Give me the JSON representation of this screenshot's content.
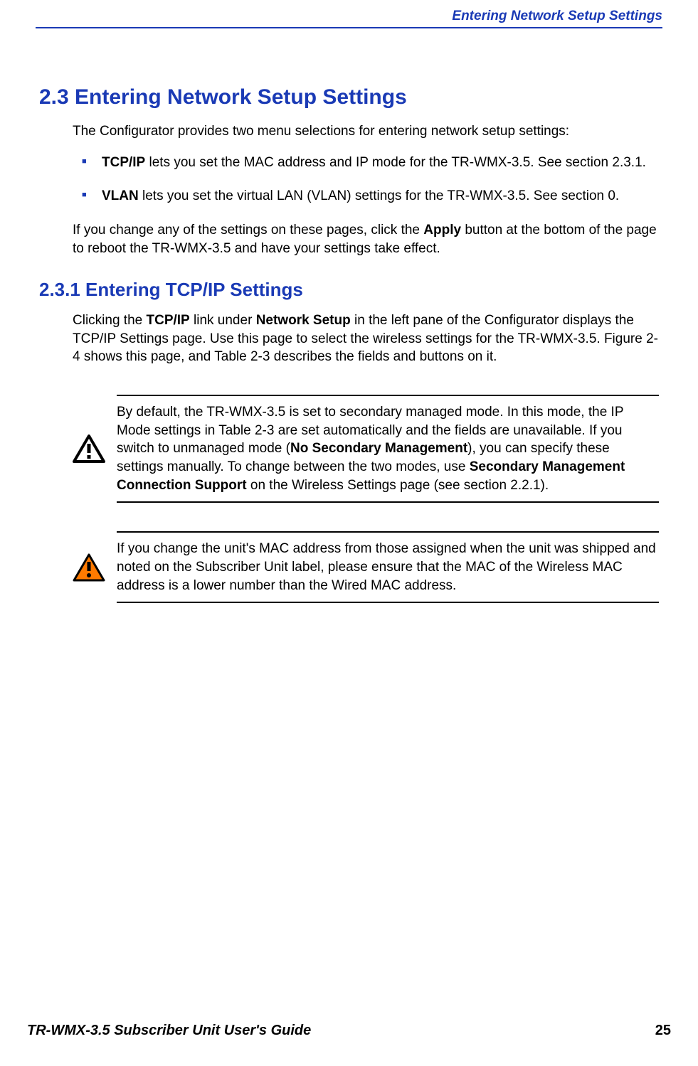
{
  "header": {
    "section_title": "Entering Network Setup Settings"
  },
  "section": {
    "heading": "2.3 Entering Network Setup Settings",
    "intro": "The Configurator provides two menu selections for entering network setup settings:",
    "bullets": [
      {
        "bold": "TCP/IP",
        "text": " lets you set the MAC address and IP mode for the TR-WMX-3.5. See section 2.3.1."
      },
      {
        "bold": "VLAN",
        "text": " lets you set the virtual LAN (VLAN) settings for the TR-WMX-3.5. See section 0."
      }
    ],
    "apply_p1": "If you change any of the settings on these pages, click the ",
    "apply_bold": "Apply",
    "apply_p2": " button at the bottom of the page to reboot the TR-WMX-3.5 and have your settings take effect."
  },
  "subsection": {
    "heading": "2.3.1 Entering TCP/IP Settings",
    "p1a": "Clicking the ",
    "p1b": "TCP/IP",
    "p1c": " link under ",
    "p1d": "Network Setup",
    "p1e": " in the left pane of the Configurator displays the TCP/IP Settings page. Use this page to select the wireless settings for the TR-WMX-3.5. Figure 2-4 shows this page, and Table 2-3 describes the fields and buttons on it."
  },
  "note1": {
    "t1": "By default, the TR-WMX-3.5 is set to secondary managed mode. In this mode, the IP Mode settings in Table 2-3 are set automatically and the fields are unavailable. If you switch to unmanaged mode (",
    "b1": "No Secondary Management",
    "t2": "), you can specify these settings manually. To change between the two modes, use ",
    "b2": "Secondary Management Connection Support",
    "t3": " on the Wireless Settings page (see section 2.2.1)."
  },
  "note2": {
    "text": "If you change the unit's MAC address from those assigned when the unit was shipped and noted on the Subscriber Unit label, please ensure that the MAC of the Wireless MAC address is a lower number than the Wired MAC address."
  },
  "footer": {
    "title": "TR-WMX-3.5 Subscriber Unit User's Guide",
    "page": "25"
  }
}
